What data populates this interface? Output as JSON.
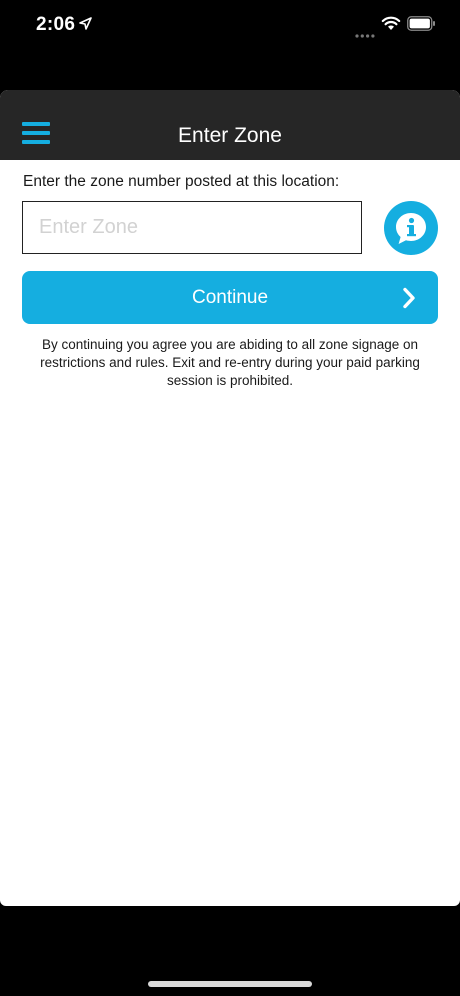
{
  "status_bar": {
    "time": "2:06",
    "location_icon": "location-arrow-icon",
    "signal_icon": "signal-dots-icon",
    "wifi_icon": "wifi-icon",
    "battery_icon": "battery-icon"
  },
  "nav": {
    "title": "Enter Zone",
    "menu_icon": "hamburger-menu-icon"
  },
  "form": {
    "instruction": "Enter the zone number posted at this location:",
    "zone_placeholder": "Enter Zone",
    "zone_value": "",
    "info_icon": "info-chat-icon"
  },
  "continue_button": {
    "label": "Continue",
    "icon": "chevron-right-icon"
  },
  "disclaimer": "By continuing you agree you are abiding to all zone signage on restrictions and rules. Exit and re-entry during your paid parking session is prohibited.",
  "colors": {
    "accent": "#15aee0",
    "nav_background": "#262626",
    "background": "#000000"
  }
}
